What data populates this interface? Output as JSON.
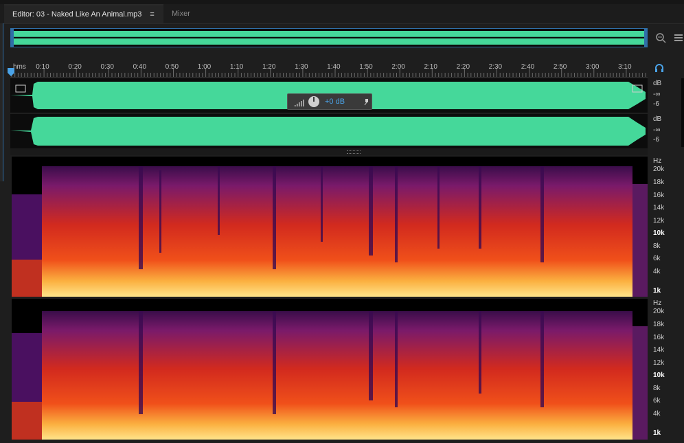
{
  "tabs": {
    "editor_label": "Editor: 03 - Naked Like An Animal.mp3",
    "editor_menu": "≡",
    "mixer_label": "Mixer"
  },
  "ruler": {
    "unit": "hms",
    "ticks": [
      "0:10",
      "0:20",
      "0:30",
      "0:40",
      "0:50",
      "1:00",
      "1:10",
      "1:20",
      "1:30",
      "1:40",
      "1:50",
      "2:00",
      "2:10",
      "2:20",
      "2:30",
      "2:40",
      "2:50",
      "3:00",
      "3:10"
    ]
  },
  "hud": {
    "volume_label": "+0 dB"
  },
  "db_scale": {
    "unit": "dB",
    "neg_inf": "-∞",
    "minus6": "-6"
  },
  "hz_scale": {
    "unit": "Hz",
    "labels": [
      "20k",
      "18k",
      "16k",
      "14k",
      "12k",
      "10k",
      "8k",
      "6k",
      "4k",
      "1k"
    ]
  },
  "colors": {
    "waveform": "#45d89a",
    "accent": "#2f6fa8",
    "hud_value": "#4aa3e8"
  }
}
